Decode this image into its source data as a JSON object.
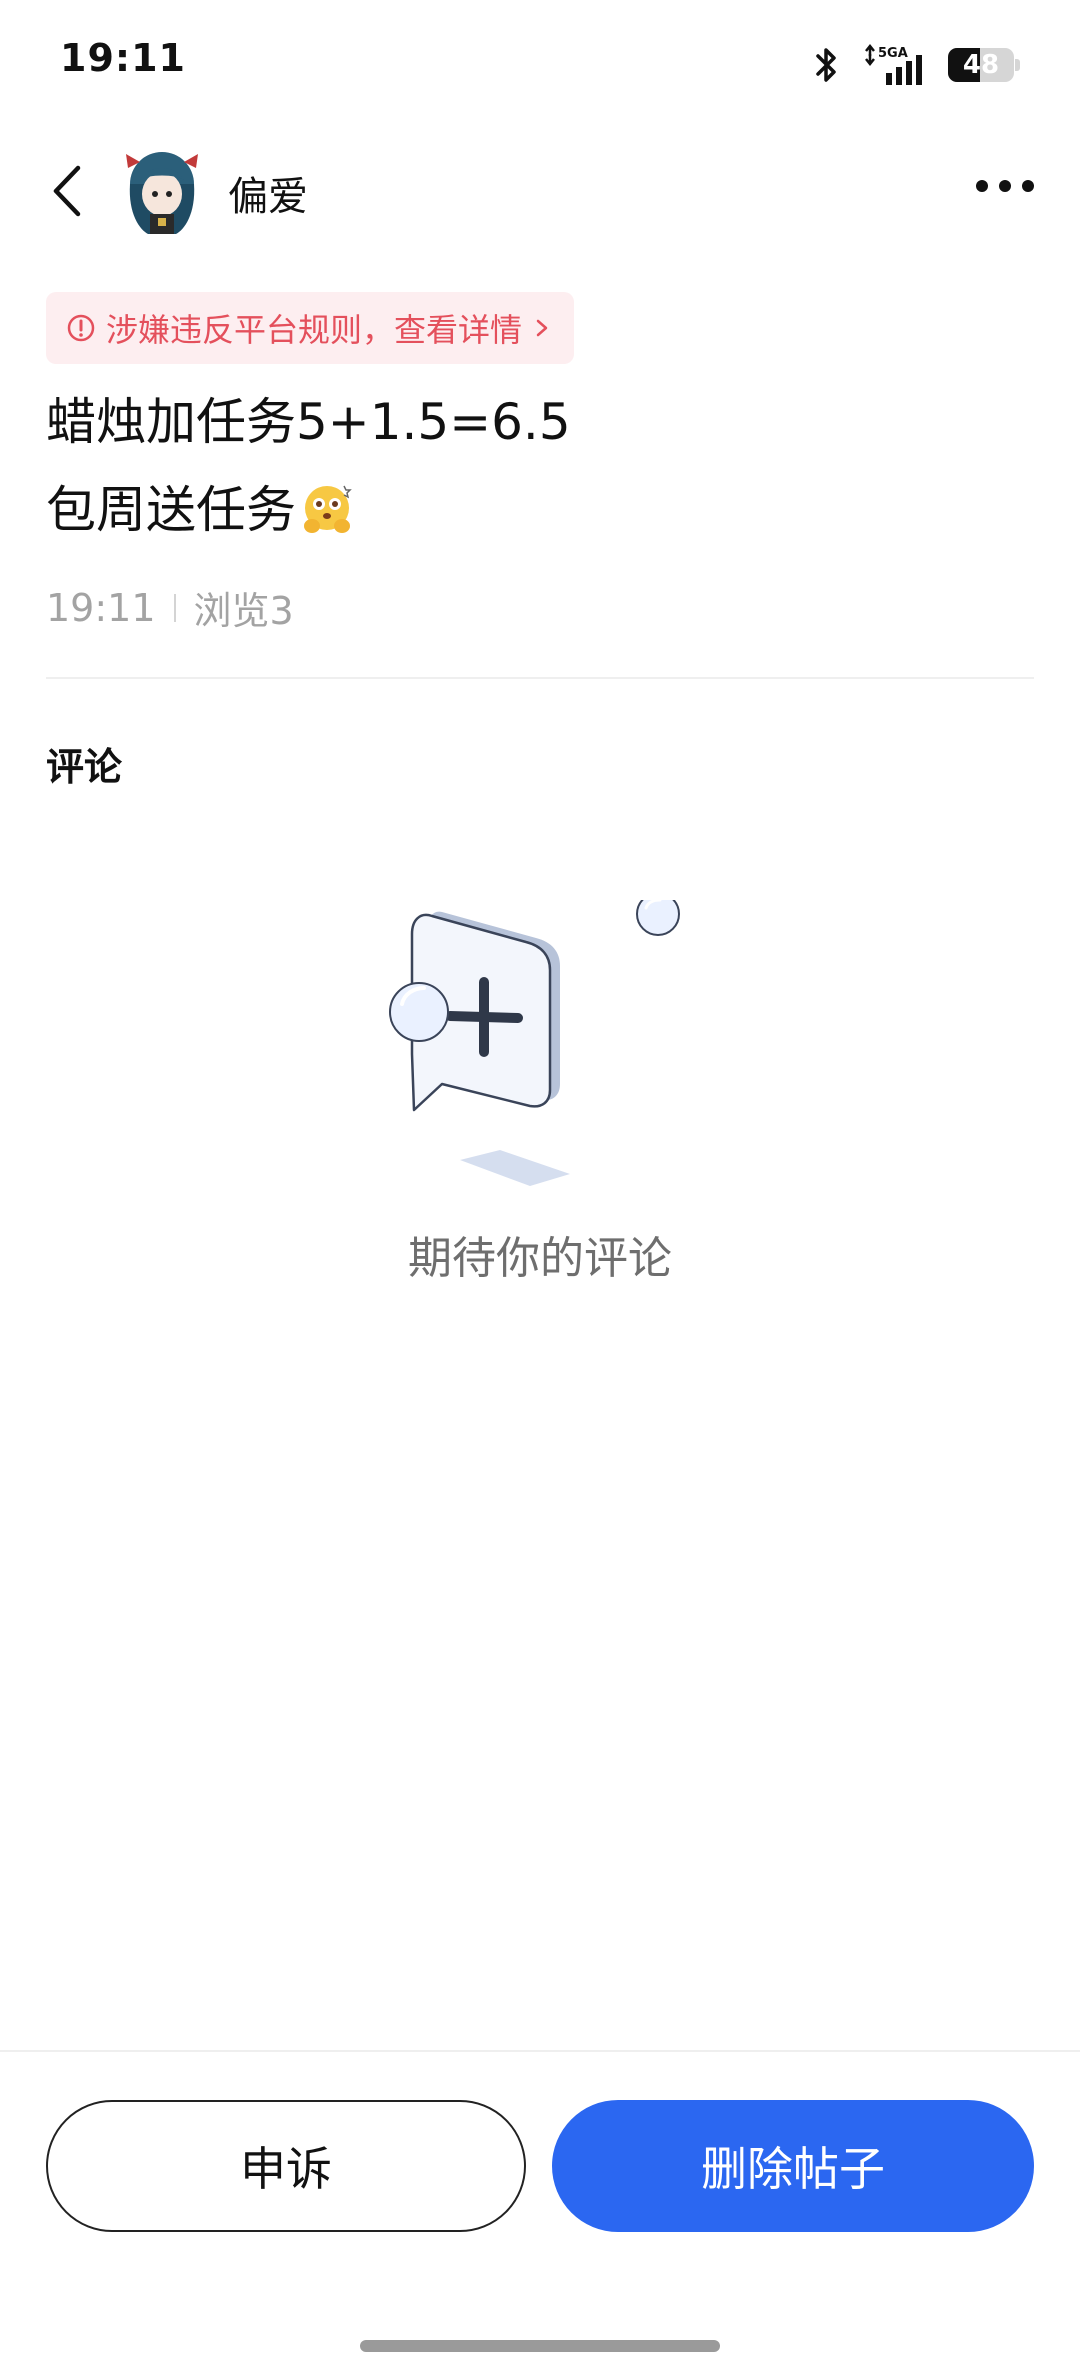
{
  "status_bar": {
    "time": "19:11",
    "network": "5GA",
    "battery": "48",
    "battery_level": 0.48
  },
  "header": {
    "username": "偏爱"
  },
  "warning": {
    "text": "涉嫌违反平台规则，查看详情",
    "color": "#e4505c"
  },
  "post": {
    "line1": "蜡烛加任务5+1.5=6.5",
    "line2": "包周送任务",
    "line2_emoji": "hugging-face-emoji",
    "time": "19:11",
    "views": "浏览3"
  },
  "comments": {
    "title": "评论",
    "empty_text": "期待你的评论"
  },
  "actions": {
    "appeal_label": "申诉",
    "delete_label": "删除帖子",
    "accent_color": "#2b67f1"
  }
}
